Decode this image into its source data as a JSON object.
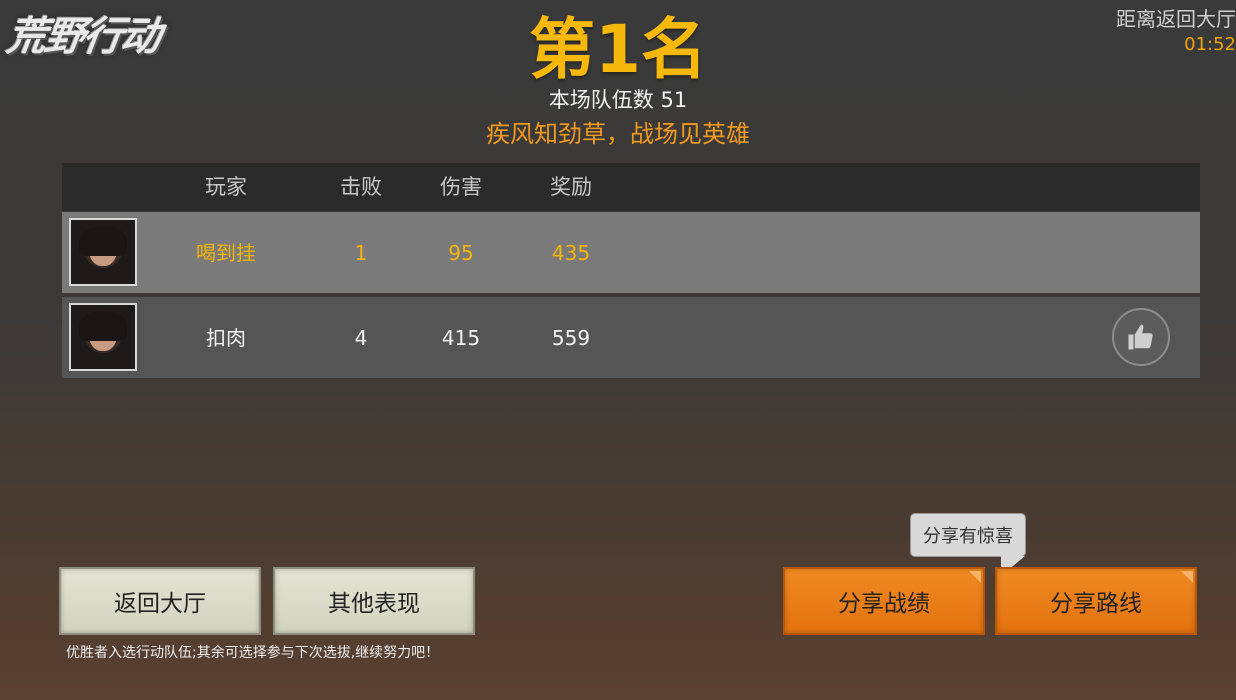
{
  "logo": "荒野行动",
  "countdown": {
    "label": "距离返回大厅",
    "time": "01:52"
  },
  "result": {
    "rank_title": "第1名",
    "team_count": "本场队伍数 51",
    "slogan": "疾风知劲草，战场见英雄"
  },
  "table": {
    "headers": {
      "player": "玩家",
      "kills": "击败",
      "damage": "伤害",
      "reward": "奖励"
    },
    "rows": [
      {
        "player": "喝到挂",
        "kills": "1",
        "damage": "95",
        "reward": "435"
      },
      {
        "player": "扣肉",
        "kills": "4",
        "damage": "415",
        "reward": "559"
      }
    ]
  },
  "buttons": {
    "back_lobby": "返回大厅",
    "other_perf": "其他表现",
    "share_record": "分享战绩",
    "share_route": "分享路线"
  },
  "tooltip": "分享有惊喜",
  "footer_note": "优胜者入选行动队伍;其余可选择参与下次选拔,继续努力吧！",
  "colors": {
    "accent_gold": "#f6b80a",
    "accent_orange": "#f08a22"
  }
}
